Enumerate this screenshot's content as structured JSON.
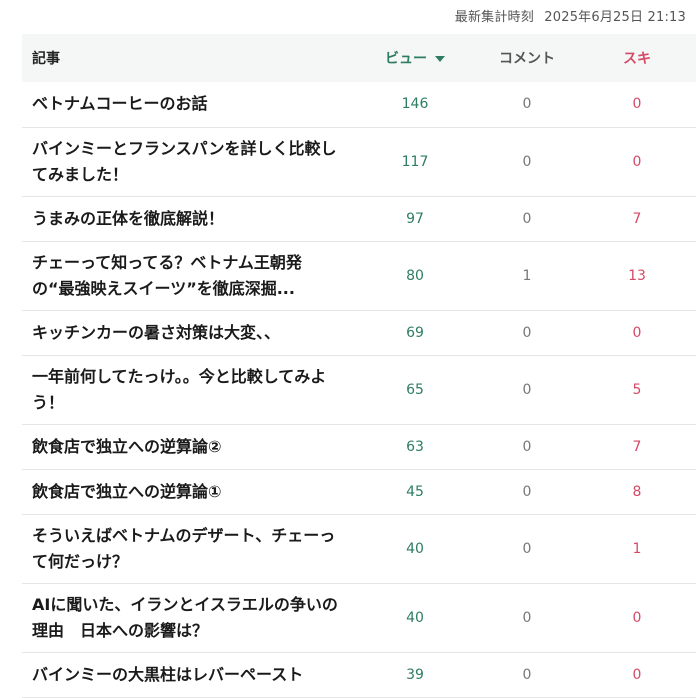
{
  "header": {
    "timestamp_label": "最新集計時刻",
    "timestamp_value": "2025年6月25日 21:13"
  },
  "columns": {
    "title": "記事",
    "views": "ビュー",
    "comments": "コメント",
    "likes": "スキ"
  },
  "sort": {
    "column": "views",
    "direction": "desc",
    "icon": "caret-down-icon"
  },
  "colors": {
    "views": "#2e7d62",
    "likes": "#d44a67",
    "header_bg": "#f5f7f6"
  },
  "rows": [
    {
      "title": "ベトナムコーヒーのお話",
      "views": "146",
      "comments": "0",
      "likes": "0"
    },
    {
      "title": "バインミーとフランスパンを詳しく比較してみました！",
      "views": "117",
      "comments": "0",
      "likes": "0"
    },
    {
      "title": "うまみの正体を徹底解説！",
      "views": "97",
      "comments": "0",
      "likes": "7"
    },
    {
      "title": "チェーって知ってる？ベトナム王朝発の“最強映えスイーツ”を徹底深掘...",
      "views": "80",
      "comments": "1",
      "likes": "13"
    },
    {
      "title": "キッチンカーの暑さ対策は大変、、",
      "views": "69",
      "comments": "0",
      "likes": "0"
    },
    {
      "title": "一年前何してたっけ。。今と比較してみよう！",
      "views": "65",
      "comments": "0",
      "likes": "5"
    },
    {
      "title": "飲食店で独立への逆算論②",
      "views": "63",
      "comments": "0",
      "likes": "7"
    },
    {
      "title": "飲食店で独立への逆算論①",
      "views": "45",
      "comments": "0",
      "likes": "8"
    },
    {
      "title": "そういえばベトナムのデザート、チェーって何だっけ？",
      "views": "40",
      "comments": "0",
      "likes": "1"
    },
    {
      "title": "AIに聞いた、イランとイスラエルの争いの理由　日本への影響は？",
      "views": "40",
      "comments": "0",
      "likes": "0"
    },
    {
      "title": "バインミーの大黒柱はレバーペースト",
      "views": "39",
      "comments": "0",
      "likes": "0"
    }
  ]
}
